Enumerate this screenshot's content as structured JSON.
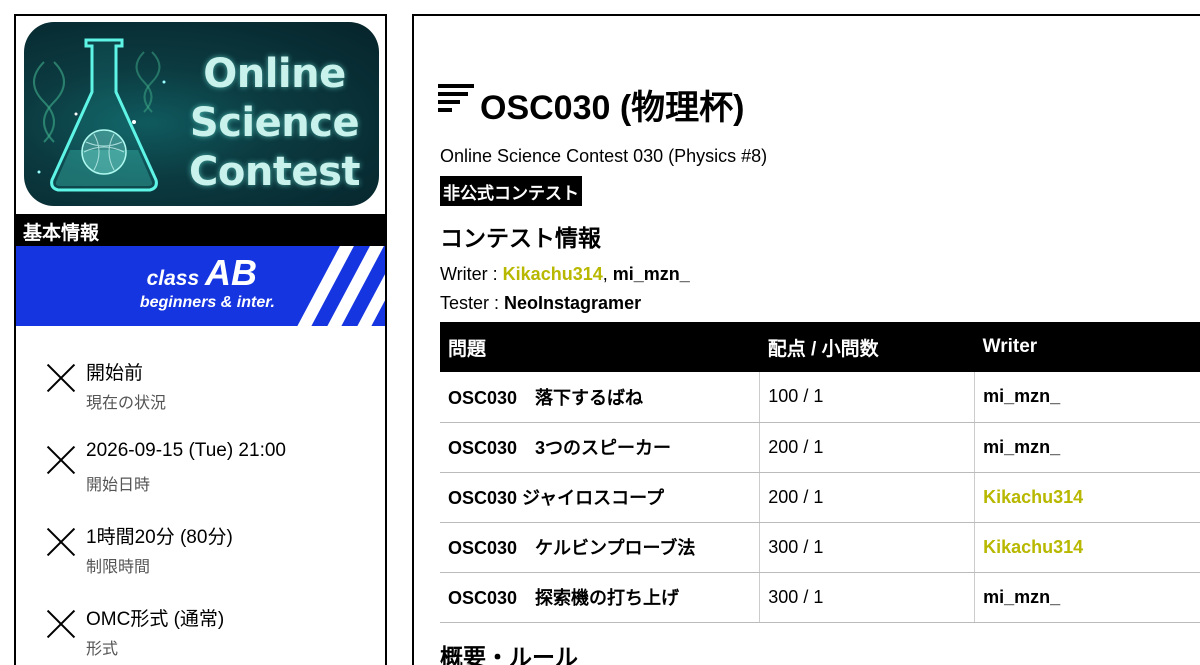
{
  "sidebar": {
    "logo_lines": [
      "Online",
      "Science",
      "Contest"
    ],
    "section_title": "基本情報",
    "class_banner": {
      "prefix": "class",
      "name": "AB",
      "subtitle": "beginners & inter."
    },
    "info": [
      {
        "value": "開始前",
        "label": "現在の状況"
      },
      {
        "value": "2026-09-15 (Tue) 21:00",
        "label": "開始日時"
      },
      {
        "value": "1時間20分 (80分)",
        "label": "制限時間"
      },
      {
        "value": "OMC形式 (通常)",
        "label": "形式"
      }
    ]
  },
  "main": {
    "title": "OSC030 (物理杯)",
    "subtitle": "Online Science Contest 030 (Physics #8)",
    "badge": "非公式コンテスト",
    "contest_info_title": "コンテスト情報",
    "writer_label": "Writer : ",
    "writers": [
      "Kikachu314",
      "mi_mzn_"
    ],
    "tester_label": "Tester : ",
    "tester": "NeoInstagramer",
    "table": {
      "headers": [
        "問題",
        "配点 / 小問数",
        "Writer"
      ],
      "rows": [
        {
          "problem": "OSC030　落下するばね",
          "score": "100 / 1",
          "writer": "mi_mzn_",
          "highlight": false
        },
        {
          "problem": "OSC030　3つのスピーカー",
          "score": "200 / 1",
          "writer": "mi_mzn_",
          "highlight": false
        },
        {
          "problem": "OSC030 ジャイロスコープ",
          "score": "200 / 1",
          "writer": "Kikachu314",
          "highlight": true
        },
        {
          "problem": "OSC030　ケルビンプローブ法",
          "score": "300 / 1",
          "writer": "Kikachu314",
          "highlight": true
        },
        {
          "problem": "OSC030　探索機の打ち上げ",
          "score": "300 / 1",
          "writer": "mi_mzn_",
          "highlight": false
        }
      ]
    },
    "rules_title": "概要・ルール"
  },
  "colors": {
    "highlight": "#b8b800",
    "banner_blue": "#1535e0"
  }
}
